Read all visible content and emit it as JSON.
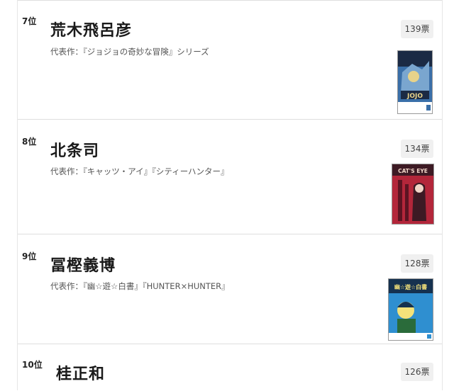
{
  "ranking": [
    {
      "rank": "7位",
      "name": "荒木飛呂彦",
      "works": "代表作：『ジョジョの奇妙な冒険』シリーズ",
      "votes": "139票",
      "cover_title": "JOJO",
      "cover_colors": {
        "bg": "#3a6fa8",
        "accent": "#e8d38a",
        "dark": "#1b2a44"
      }
    },
    {
      "rank": "8位",
      "name": "北条司",
      "works": "代表作：『キャッツ・アイ』『シティーハンター』",
      "votes": "134票",
      "cover_title": "CAT'S EYE",
      "cover_colors": {
        "bg": "#b3263a",
        "accent": "#f1d6c8",
        "dark": "#3d1a24"
      }
    },
    {
      "rank": "9位",
      "name": "冨樫義博",
      "works": "代表作：『幽☆遊☆白書』『HUNTER×HUNTER』",
      "votes": "128票",
      "cover_title": "幽☆遊☆白書",
      "cover_colors": {
        "bg": "#2f8fd0",
        "accent": "#f4e27a",
        "dark": "#15314f"
      }
    },
    {
      "rank": "10位",
      "name": "桂正和",
      "works": "",
      "votes": "126票",
      "cover_title": "",
      "cover_colors": {
        "bg": "#cccccc",
        "accent": "#eeeeee",
        "dark": "#888888"
      }
    }
  ]
}
